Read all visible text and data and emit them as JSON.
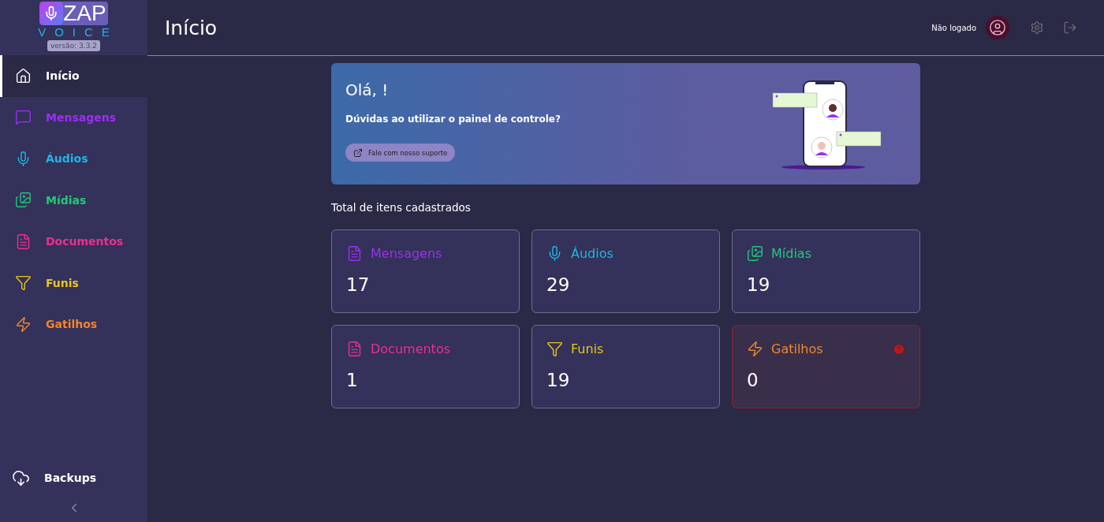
{
  "logo": {
    "word": "ZAP",
    "subword": "VOICE",
    "version": "versão: 3.3.2"
  },
  "sidebar": {
    "items": [
      {
        "label": "Início",
        "kind": "home",
        "color": "#ffffff",
        "selected": true
      },
      {
        "label": "Mensagens",
        "kind": "message",
        "color": "#9b30f0",
        "selected": false
      },
      {
        "label": "Áudios",
        "kind": "mic",
        "color": "#1fb6e8",
        "selected": false
      },
      {
        "label": "Mídias",
        "kind": "image",
        "color": "#22c97a",
        "selected": false
      },
      {
        "label": "Documentos",
        "kind": "document",
        "color": "#ec2f8f",
        "selected": false
      },
      {
        "label": "Funis",
        "kind": "funnel",
        "color": "#e8c61a",
        "selected": false
      },
      {
        "label": "Gatilhos",
        "kind": "bolt",
        "color": "#f0862a",
        "selected": false
      }
    ],
    "footer": {
      "label": "Backups"
    }
  },
  "header": {
    "title": "Início",
    "user_status": "Não logado"
  },
  "banner": {
    "greeting": "Olá, !",
    "question": "Dúvidas ao utilizar o painel de controle?",
    "button": "Fale com nosso suporte"
  },
  "section_title": "Total de itens cadastrados",
  "cards": [
    {
      "label": "Mensagens",
      "kind": "document",
      "color": "#9b30f0",
      "count": "17",
      "alert": false
    },
    {
      "label": "Áudios",
      "kind": "mic",
      "color": "#1fb6e8",
      "count": "29",
      "alert": false
    },
    {
      "label": "Mídias",
      "kind": "image",
      "color": "#22c97a",
      "count": "19",
      "alert": false
    },
    {
      "label": "Documentos",
      "kind": "document",
      "color": "#ec2f8f",
      "count": "1",
      "alert": false
    },
    {
      "label": "Funis",
      "kind": "funnel",
      "color": "#e8c61a",
      "count": "19",
      "alert": false
    },
    {
      "label": "Gatilhos",
      "kind": "bolt",
      "color": "#f0862a",
      "count": "0",
      "alert": true
    }
  ]
}
